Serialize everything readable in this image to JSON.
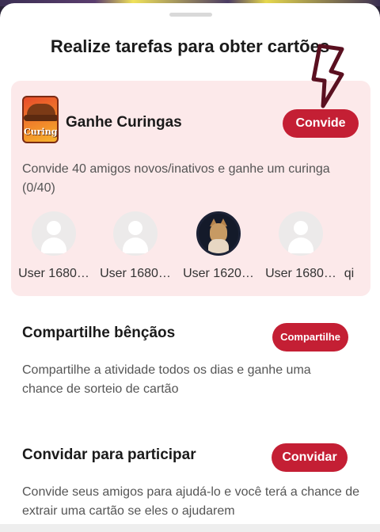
{
  "page_title": "Realize tarefas para obter cartões",
  "task_invite": {
    "icon": "curinga-cowboy-hat-icon",
    "icon_text": "Curinga",
    "name": "Ganhe Curingas",
    "button_label": "Convide",
    "description": "Convide 40 amigos novos/inativos e ganhe um curinga (0/40)",
    "friends": [
      {
        "name": "User 1680…",
        "avatar": "default-user-icon"
      },
      {
        "name": "User 1680…",
        "avatar": "default-user-icon"
      },
      {
        "name": "User 1620…",
        "avatar": "cat-photo"
      },
      {
        "name": "User 1680…",
        "avatar": "default-user-icon"
      },
      {
        "name": "qi",
        "avatar": "none"
      }
    ]
  },
  "task_share": {
    "name": "Compartilhe bênçãos",
    "button_label": "Compartilhe",
    "description": "Compartilhe a atividade todos os dias e ganhe uma chance de sorteio de cartão"
  },
  "task_participate": {
    "name": "Convidar para participar",
    "button_label": "Convidar",
    "description": "Convide seus amigos para ajudá-lo e você terá a chance de extrair uma cartão se eles o ajudarem"
  },
  "colors": {
    "accent": "#c41f34",
    "card_bg": "#fce9ea",
    "arrow": "#5a1020"
  }
}
